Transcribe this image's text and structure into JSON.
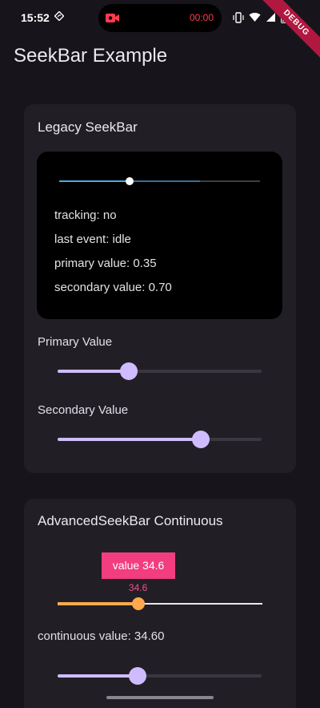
{
  "status_bar": {
    "time": "15:52",
    "recording_time": "00:00",
    "debug_label": "DEBUG"
  },
  "app_bar": {
    "title": "SeekBar Example"
  },
  "legacy_card": {
    "title": "Legacy SeekBar",
    "seekbar": {
      "primary": 0.35,
      "secondary": 0.7
    },
    "info": {
      "tracking": "tracking: no",
      "last_event": "last event: idle",
      "primary_value": "primary value: 0.35",
      "secondary_value": "secondary value: 0.70"
    },
    "primary_label": "Primary Value",
    "primary_slider": 0.35,
    "secondary_label": "Secondary Value",
    "secondary_slider": 0.7
  },
  "advanced_card": {
    "title": "AdvancedSeekBar Continuous",
    "badge": "value 34.6",
    "small_value": "34.6",
    "slider_fraction": 0.393,
    "continuous_label": "continuous value: 34.60",
    "lower_slider": 0.393
  },
  "colors": {
    "background": "#17151b",
    "card": "#211f25",
    "m3_accent": "#cfbcff",
    "advanced_accent": "#ffa94d",
    "badge": "#f23d7f",
    "legacy_primary": "#4ea9e3"
  }
}
